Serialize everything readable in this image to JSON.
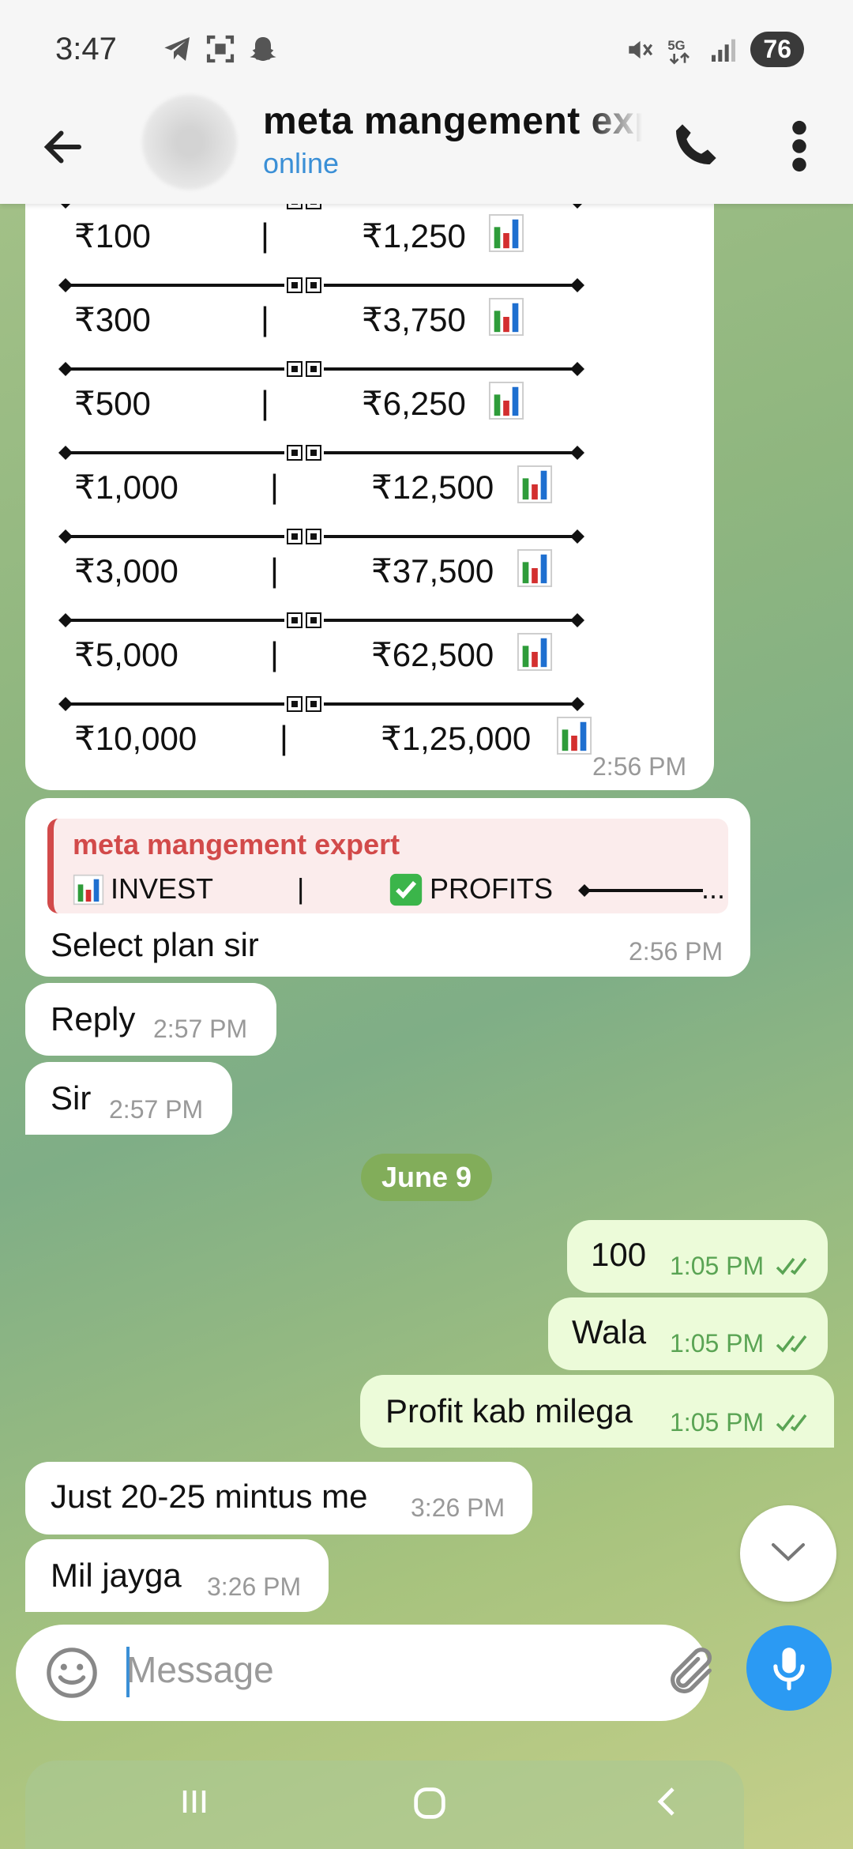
{
  "status": {
    "time": "3:47",
    "battery": "76",
    "net": "5G"
  },
  "header": {
    "title": "meta mangement expert",
    "status": "online"
  },
  "plan": {
    "rows": [
      {
        "amount": "₹100",
        "profit": "₹1,250"
      },
      {
        "amount": "₹300",
        "profit": "₹3,750"
      },
      {
        "amount": "₹500",
        "profit": "₹6,250"
      },
      {
        "amount": "₹1,000",
        "profit": "₹12,500"
      },
      {
        "amount": "₹3,000",
        "profit": "₹37,500"
      },
      {
        "amount": "₹5,000",
        "profit": "₹62,500"
      },
      {
        "amount": "₹10,000",
        "profit": "₹1,25,000"
      }
    ],
    "divider": "|",
    "time": "2:56 PM"
  },
  "quote": {
    "author": "meta mangement expert",
    "invest": "INVEST",
    "bar": "|",
    "profits": "PROFITS",
    "ellipsis": "...",
    "text": "Select plan sir",
    "time": "2:56 PM"
  },
  "messages": [
    {
      "text": "Reply",
      "time": "2:57 PM"
    },
    {
      "text": "Sir",
      "time": "2:57 PM"
    },
    {
      "text": "100",
      "time": "1:05 PM"
    },
    {
      "text": "Wala",
      "time": "1:05 PM"
    },
    {
      "text": "Profit kab milega",
      "time": "1:05 PM"
    },
    {
      "text": "Just 20-25 mintus me",
      "time": "3:26 PM"
    },
    {
      "text": "Mil jayga",
      "time": "3:26 PM"
    }
  ],
  "date_chip": "June 9",
  "composer": {
    "placeholder": "Message"
  },
  "colors": {
    "accent": "#2b9af3",
    "outgoing": "#ecfbd9",
    "date_chip": "#82ad5a",
    "quote_name": "#d24a4a"
  }
}
